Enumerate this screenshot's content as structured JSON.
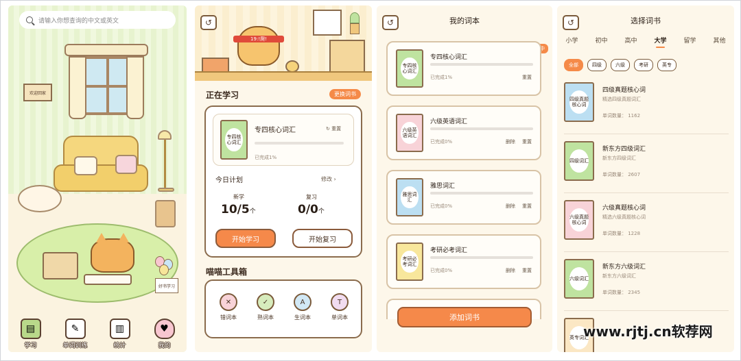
{
  "home": {
    "search_placeholder": "请输入你想查询的中文或英文",
    "sign_text": "欢迎回家",
    "tag_text": "好书学习",
    "nav": [
      {
        "label": "学习",
        "icon": "book-icon"
      },
      {
        "label": "单词训练",
        "icon": "paper-icon"
      },
      {
        "label": "统计",
        "icon": "chart-icon"
      },
      {
        "label": "我的",
        "icon": "cat-heart-icon"
      }
    ]
  },
  "study": {
    "hero_band": "19:!爬!",
    "learning_title": "正在学习",
    "change_book": "更换词书",
    "current_book": {
      "cover": "专四核心词汇",
      "name": "专四核心词汇",
      "reset": "重置",
      "progress_text": "已完成1%"
    },
    "plan_title": "今日计划",
    "plan_edit": "修改",
    "new_label": "新学",
    "new_value": "10/5",
    "review_label": "复习",
    "review_value": "0/0",
    "unit": "个",
    "start_learn": "开始学习",
    "start_review": "开始复习",
    "toolbox_title": "喵喵工具箱",
    "tools": [
      {
        "label": "错词本",
        "glyph": "✕"
      },
      {
        "label": "熟词本",
        "glyph": "✓"
      },
      {
        "label": "生词本",
        "glyph": "A"
      },
      {
        "label": "单词本",
        "glyph": "T"
      }
    ]
  },
  "mybooks": {
    "title": "我的词本",
    "badge": "学习中",
    "books": [
      {
        "cover": "专四核心词汇",
        "name": "专四核心词汇",
        "progress": "已完成1%",
        "actions": [
          "重置"
        ],
        "color": "#bfe3a0"
      },
      {
        "cover": "六级英语词汇",
        "name": "六级英语词汇",
        "progress": "已完成0%",
        "actions": [
          "删除",
          "重置"
        ],
        "color": "#f8d3d8"
      },
      {
        "cover": "雅思词汇",
        "name": "雅思词汇",
        "progress": "已完成0%",
        "actions": [
          "删除",
          "重置"
        ],
        "color": "#bcdff2"
      },
      {
        "cover": "考研必考词汇",
        "name": "考研必考词汇",
        "progress": "已完成0%",
        "actions": [
          "删除",
          "重置"
        ],
        "color": "#f8e79c"
      }
    ],
    "add_button": "添加词书"
  },
  "select": {
    "title": "选择词书",
    "tabs": [
      "小学",
      "初中",
      "高中",
      "大学",
      "留学",
      "其他"
    ],
    "active_tab": "大学",
    "filters": [
      "全部",
      "四级",
      "六级",
      "考研",
      "英专"
    ],
    "active_filter": "全部",
    "items": [
      {
        "cover": "四级真题核心词",
        "name": "四级真题核心词",
        "desc": "精选四级真题词汇",
        "count": "单词数量： 1162",
        "color": "#bcdff2"
      },
      {
        "cover": "四级词汇",
        "name": "新东方四级词汇",
        "desc": "新东方四级词汇",
        "count": "单词数量： 2607",
        "color": "#bfe3a0"
      },
      {
        "cover": "六级真题核心词",
        "name": "六级真题核心词",
        "desc": "精选六级真题核心词",
        "count": "单词数量： 1228",
        "color": "#f8d3d8"
      },
      {
        "cover": "六级词汇",
        "name": "新东方六级词汇",
        "desc": "新东方六级词汇",
        "count": "单词数量： 2345",
        "color": "#bfe3a0"
      },
      {
        "cover": "英专词汇",
        "name": "",
        "desc": "",
        "count": "",
        "color": "#fbe7c4"
      }
    ]
  },
  "watermark": "www.rjtj.cn软荐网"
}
